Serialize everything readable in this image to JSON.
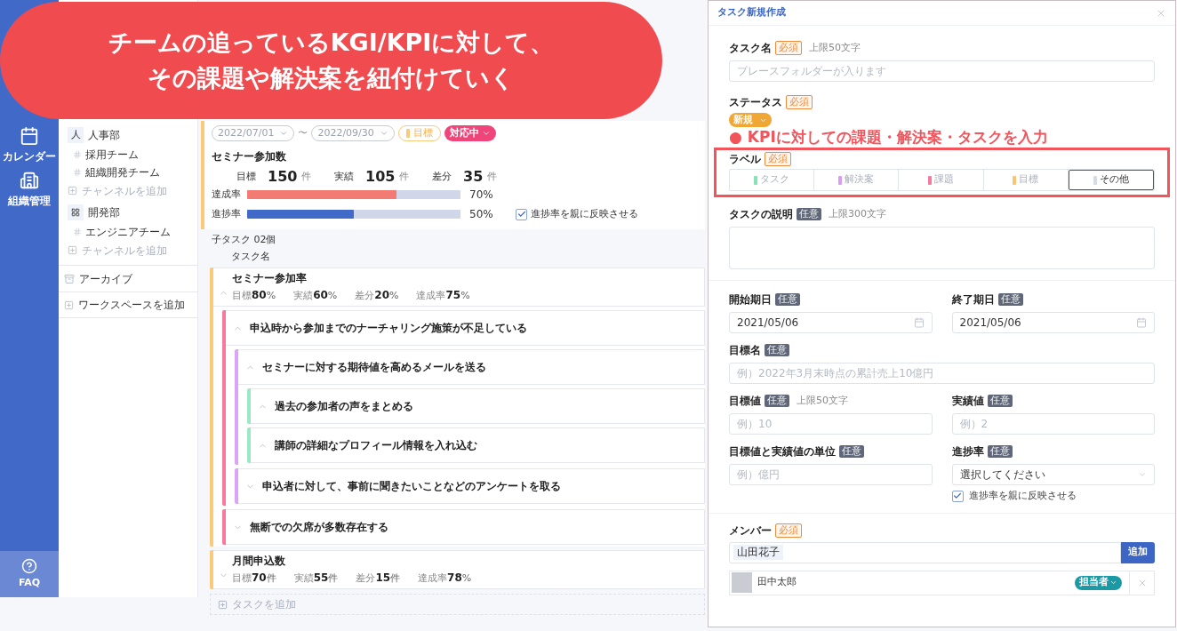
{
  "banner": {
    "lines": [
      "チームの追っているKGI/KPIに対して、",
      "その課題や解決案を紐付けていく"
    ]
  },
  "nav": {
    "items": [
      {
        "label": "カレンダー",
        "kind": "calendar",
        "selected": false
      },
      {
        "label": "組織管理",
        "kind": "org",
        "selected": false
      }
    ],
    "faq": "FAQ"
  },
  "sidebar": {
    "groups": [
      {
        "name": "人事部",
        "icon_text": "人",
        "channels": [
          "採用チーム",
          "組織開発チーム"
        ],
        "add": "チャンネルを追加"
      },
      {
        "name": "開発部",
        "channels": [
          "エンジニアチーム"
        ],
        "add": "チャンネルを追加"
      }
    ],
    "archive": "アーカイブ",
    "add_workspace": "ワークスペースを追加"
  },
  "main": {
    "filters": {
      "start": "2022/07/01",
      "separator": "〜",
      "end": "2022/09/30",
      "label": "目標",
      "status": "対応中"
    },
    "kpi": {
      "title": "セミナー参加数",
      "metrics": [
        {
          "label": "目標",
          "value": "150",
          "unit": "件"
        },
        {
          "label": "実績",
          "value": "105",
          "unit": "件"
        },
        {
          "label": "差分",
          "value": "35",
          "unit": "件"
        }
      ],
      "bars": [
        {
          "label": "達成率",
          "kind": "achievement",
          "level": 0.7,
          "reading": "70%"
        },
        {
          "label": "進捗率",
          "kind": "progress",
          "level": 0.5,
          "reading": "50%"
        }
      ],
      "reflect": {
        "label": "進捗率を親に反映させる",
        "checked": true
      }
    },
    "subtasks": {
      "count": "子タスク 02個",
      "column": "タスク名",
      "add": "タスクを追加",
      "items": [
        {
          "kind": "kpi",
          "title": "セミナー参加率",
          "color": "#fbc97a",
          "expanded": true,
          "metrics": [
            {
              "label": "目標",
              "value": "80",
              "unit": "%"
            },
            {
              "label": "実績",
              "value": "60",
              "unit": "%"
            },
            {
              "label": "差分",
              "value": "20",
              "unit": "%"
            },
            {
              "label": "達成率",
              "value": "75",
              "unit": "%"
            }
          ],
          "children": [
            {
              "kind": "task",
              "title": "申込時から参加までのナーチャリング施策が不足している",
              "color": "#f7799e",
              "expanded": true,
              "children": [
                {
                  "kind": "task",
                  "title": "セミナーに対する期待値を高めるメールを送る",
                  "color": "#dca4f7",
                  "expanded": true,
                  "children": [
                    {
                      "kind": "task",
                      "title": "過去の参加者の声をまとめる",
                      "color": "#9be8c4",
                      "expanded": true
                    },
                    {
                      "kind": "task",
                      "title": "講師の詳細なプロフィール情報を入れ込む",
                      "color": "#9be8c4",
                      "expanded": true
                    }
                  ]
                },
                {
                  "kind": "task",
                  "title": "申込者に対して、事前に聞きたいことなどのアンケートを取る",
                  "color": "#dca4f7",
                  "expanded": false
                }
              ]
            },
            {
              "kind": "task",
              "title": "無断での欠席が多数存在する",
              "color": "#f7799e",
              "expanded": false
            }
          ]
        },
        {
          "kind": "kpi",
          "title": "月間申込数",
          "color": "#fbc97a",
          "expanded": false,
          "metrics": [
            {
              "label": "目標",
              "value": "70",
              "unit": "件"
            },
            {
              "label": "実績",
              "value": "55",
              "unit": "件"
            },
            {
              "label": "差分",
              "value": "15",
              "unit": "件"
            },
            {
              "label": "達成率",
              "value": "78",
              "unit": "%"
            }
          ]
        }
      ]
    }
  },
  "form": {
    "title": "タスク新規作成",
    "task_name": {
      "label": "タスク名",
      "tag": {
        "text": "必須",
        "kind": "required"
      },
      "hint": "上限50文字",
      "placeholder": "プレースフォルダーが入ります"
    },
    "status": {
      "label": "ステータス",
      "tag": {
        "text": "必須",
        "kind": "required"
      },
      "value": "新規"
    },
    "annotation": "● KPIに対しての課題・解決案・タスクを入力",
    "label_field": {
      "label": "ラベル",
      "tag": {
        "text": "必須",
        "kind": "required"
      },
      "options": [
        {
          "text": "タスク",
          "color": "#86e3b5",
          "selected": false
        },
        {
          "text": "解決案",
          "color": "#d99cf5",
          "selected": false
        },
        {
          "text": "課題",
          "color": "#f57aa0",
          "selected": false
        },
        {
          "text": "目標",
          "color": "#fbc46f",
          "selected": false
        },
        {
          "text": "その他",
          "color": "#d7dbe3",
          "selected": true
        }
      ]
    },
    "description": {
      "label": "タスクの説明",
      "tag": {
        "text": "任意",
        "kind": "optional"
      },
      "hint": "上限300文字"
    },
    "start_date": {
      "label": "開始期日",
      "tag": {
        "text": "任意",
        "kind": "optional"
      },
      "value": "2021/05/06"
    },
    "end_date": {
      "label": "終了期日",
      "tag": {
        "text": "任意",
        "kind": "optional"
      },
      "value": "2021/05/06"
    },
    "goal_name": {
      "label": "目標名",
      "tag": {
        "text": "任意",
        "kind": "optional"
      },
      "placeholder": "例）2022年3月末時点の累計売上10億円"
    },
    "goal_value": {
      "label": "目標値",
      "tag": {
        "text": "任意",
        "kind": "optional"
      },
      "hint": "上限50文字",
      "placeholder": "例）10"
    },
    "actual_value": {
      "label": "実績値",
      "tag": {
        "text": "任意",
        "kind": "optional"
      },
      "placeholder": "例）2"
    },
    "unit": {
      "label": "目標値と実績値の単位",
      "tag": {
        "text": "任意",
        "kind": "optional"
      },
      "placeholder": "例）億円"
    },
    "progress": {
      "label": "進捗率",
      "tag": {
        "text": "任意",
        "kind": "optional"
      },
      "value": "選択してください",
      "reflect": {
        "label": "進捗率を親に反映させる",
        "checked": true
      }
    },
    "members": {
      "label": "メンバー",
      "tag": {
        "text": "必須",
        "kind": "required"
      },
      "chip": "山田花子",
      "add": "追加",
      "list": [
        {
          "name": "田中太郎",
          "role": "担当者"
        }
      ]
    }
  }
}
